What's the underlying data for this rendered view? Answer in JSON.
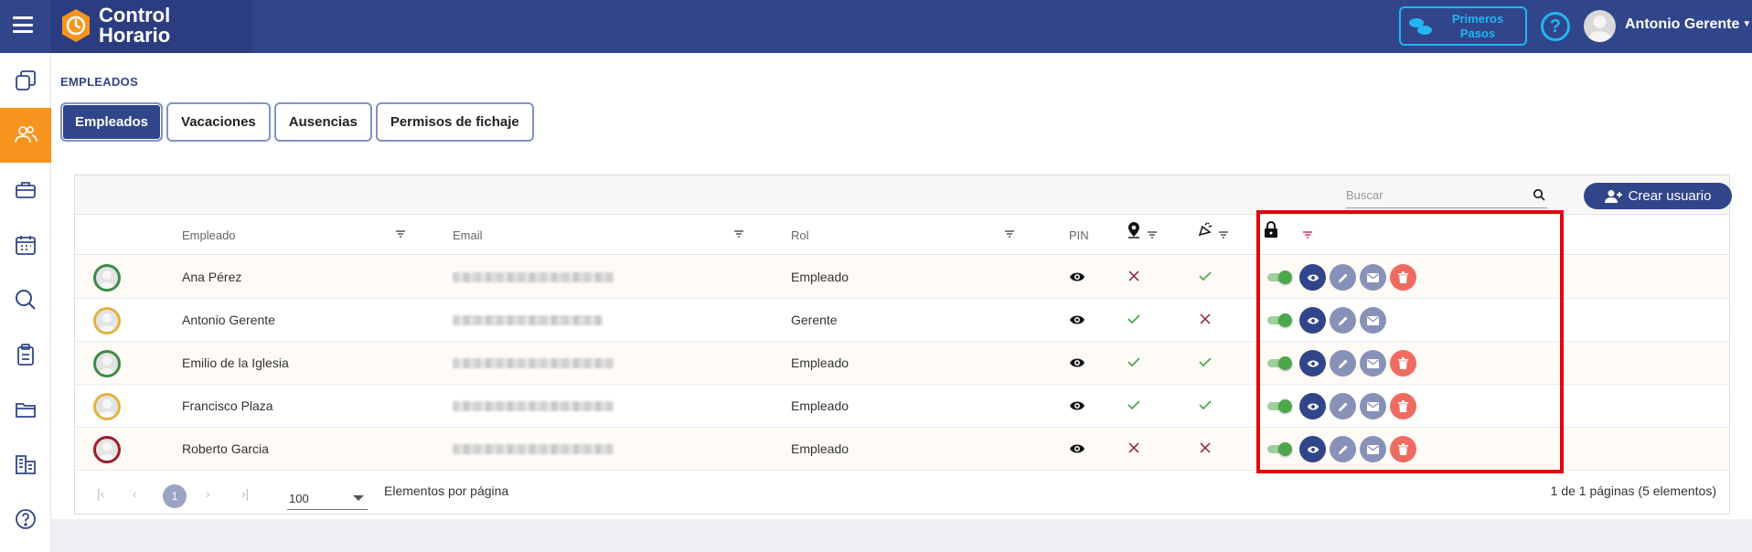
{
  "topbar": {
    "brand_line1": "Control",
    "brand_line2": "Horario",
    "primeros_line1": "Primeros",
    "primeros_line2": "Pasos",
    "help_label": "?",
    "user_name": "Antonio Gerente"
  },
  "page": {
    "title": "EMPLEADOS",
    "tabs": [
      "Empleados",
      "Vacaciones",
      "Ausencias",
      "Permisos de fichaje"
    ]
  },
  "toolbar": {
    "search_placeholder": "Buscar",
    "create_label": "Crear usuario"
  },
  "table": {
    "columns": {
      "employee": "Empleado",
      "email": "Email",
      "role": "Rol",
      "pin": "PIN"
    },
    "rows": [
      {
        "name": "Ana Pérez",
        "role": "Empleado",
        "geo": "no",
        "remote": "yes",
        "active": true,
        "avatar_color": "#3d8b46",
        "can_delete": true
      },
      {
        "name": "Antonio Gerente",
        "role": "Gerente",
        "geo": "yes",
        "remote": "no",
        "active": true,
        "avatar_color": "#e0b442",
        "can_delete": false
      },
      {
        "name": "Emilio de la Iglesia",
        "role": "Empleado",
        "geo": "yes",
        "remote": "yes",
        "active": true,
        "avatar_color": "#3d8b46",
        "can_delete": true
      },
      {
        "name": "Francisco Plaza",
        "role": "Empleado",
        "geo": "yes",
        "remote": "yes",
        "active": true,
        "avatar_color": "#e0b442",
        "can_delete": true
      },
      {
        "name": "Roberto Garcia",
        "role": "Empleado",
        "geo": "no",
        "remote": "no",
        "active": true,
        "avatar_color": "#9c1d2b",
        "can_delete": true
      }
    ]
  },
  "paginator": {
    "current_page": "1",
    "page_size": "100",
    "page_size_label": "Elementos por página",
    "range_label": "1 de 1 páginas (5 elementos)"
  },
  "colors": {
    "primary": "#31458b",
    "accent_orange": "#f7941d",
    "cyan": "#21b6ef",
    "check_green": "#4ca74a",
    "cross_red": "#8b1a3a",
    "delete_red": "#ef6b61",
    "highlight_red": "#e2050f"
  }
}
